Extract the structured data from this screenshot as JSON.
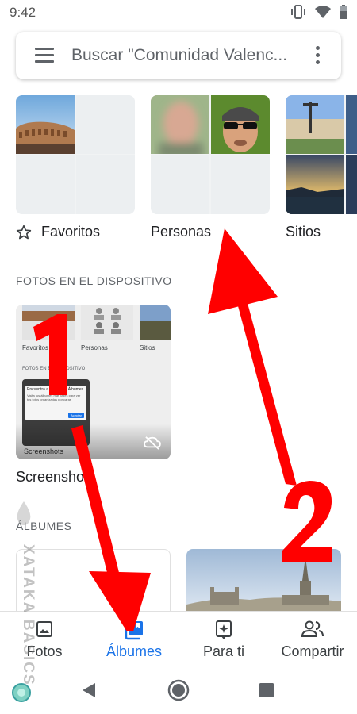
{
  "status_bar": {
    "time": "9:42",
    "icons": [
      "vibrate-icon",
      "wifi-icon",
      "battery-icon"
    ]
  },
  "search": {
    "placeholder": "Buscar \"Comunidad Valenc...",
    "menu_icon": "hamburger-menu-icon",
    "more_icon": "more-vert-icon"
  },
  "albums": [
    {
      "label": "Favoritos",
      "icon": "star-outline-icon"
    },
    {
      "label": "Personas"
    },
    {
      "label": "Sitios"
    }
  ],
  "sections": {
    "device": "FOTOS EN EL DISPOSITIVO",
    "albums": "ÁLBUMES"
  },
  "device_folders": [
    {
      "label": "Screenshots",
      "icon": "cloud-off-icon"
    }
  ],
  "device_preview": {
    "albums": [
      "Favoritos",
      "Personas",
      "Sitios"
    ],
    "section": "FOTOS EN EL DISPOSITIVO",
    "dialog_title": "Encuentra a tu gente y Álbumes",
    "dialog_body": "Visita tus álbumes más útiles para ver tus fotos organizadas por caras",
    "dialog_button": "Aceptar",
    "folder": "Screenshots"
  },
  "bottom_nav": {
    "items": [
      {
        "label": "Fotos",
        "icon": "photo-icon",
        "active": false
      },
      {
        "label": "Álbumes",
        "icon": "albums-icon",
        "active": true
      },
      {
        "label": "Para ti",
        "icon": "sparkle-icon",
        "active": false
      },
      {
        "label": "Compartir",
        "icon": "people-icon",
        "active": false
      }
    ],
    "active_color": "#1a73e8"
  },
  "system_nav": [
    "back-icon",
    "home-icon",
    "recents-icon"
  ],
  "annotations": {
    "color": "#ff0000",
    "arrow1_number": "1",
    "arrow2_number": "2"
  },
  "watermark": "XATAKA BASICS"
}
